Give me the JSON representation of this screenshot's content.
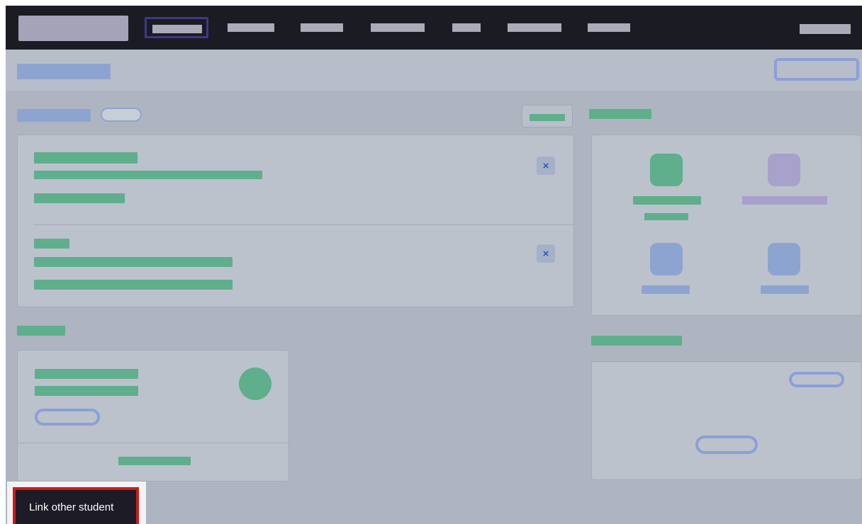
{
  "link_other_student_label": "Link other student",
  "remove_icon_glyph": "×",
  "colors": {
    "topbar": "#1b1b24",
    "accent_green": "#5fae8c",
    "accent_blue": "#8ea4d0",
    "accent_purple": "#a7a1cc",
    "highlight_border": "#cc1a1a"
  },
  "icons": [
    "close-icon",
    "close-icon",
    "app-icon-green",
    "app-icon-purple",
    "app-icon-blue",
    "app-icon-blue"
  ]
}
